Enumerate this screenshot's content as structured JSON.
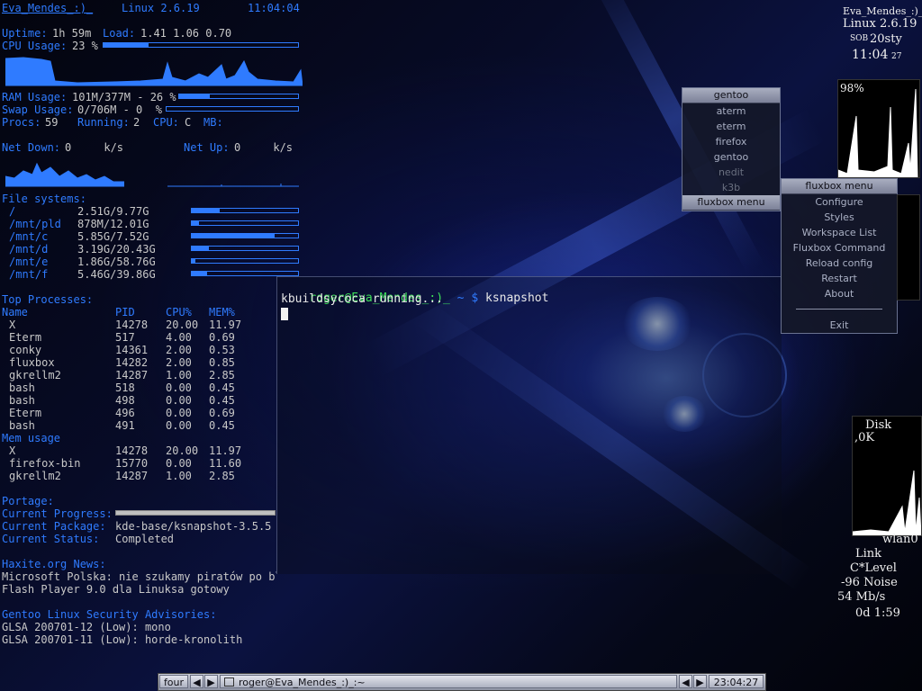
{
  "conky": {
    "hostname": "Eva_Mendes_:)_",
    "kernel": "Linux 2.6.19",
    "time": "11:04:04",
    "uptime_label": "Uptime:",
    "uptime_value": "1h 59m",
    "load_label": "Load:",
    "load_value": "1.41 1.06 0.70",
    "cpu_label": "CPU Usage:",
    "cpu_value": "23 %",
    "cpu_fraction": 0.23,
    "ram_label": "RAM Usage:",
    "ram_value": "101M/377M - 26 %",
    "ram_fraction": 0.26,
    "swap_label": "Swap Usage:",
    "swap_value": "0/706M - 0  %",
    "swap_fraction": 0.0,
    "procs_label": "Procs:",
    "procs_value": "59",
    "running_label": "Running:",
    "running_value": "2",
    "cpu2_label": "CPU:",
    "cpu2_value": "C",
    "mb_label": "MB:",
    "netdown_label": "Net Down:",
    "netdown_value": "0     k/s",
    "netup_label": "Net Up:",
    "netup_value": "0     k/s",
    "fs_header": "File systems:",
    "filesystems": [
      {
        "mount": "/",
        "usage": "2.51G/9.77G",
        "fraction": 0.26
      },
      {
        "mount": "/mnt/pld",
        "usage": "878M/12.01G",
        "fraction": 0.07
      },
      {
        "mount": "/mnt/c",
        "usage": "5.85G/7.52G",
        "fraction": 0.78
      },
      {
        "mount": "/mnt/d",
        "usage": "3.19G/20.43G",
        "fraction": 0.16
      },
      {
        "mount": "/mnt/e",
        "usage": "1.86G/58.76G",
        "fraction": 0.03
      },
      {
        "mount": "/mnt/f",
        "usage": "5.46G/39.86G",
        "fraction": 0.14
      }
    ],
    "top_header": "Top Processes:",
    "cols": {
      "name": "Name",
      "pid": "PID",
      "cpu": "CPU%",
      "mem": "MEM%"
    },
    "top_processes": [
      {
        "name": "X",
        "pid": "14278",
        "cpu": "20.00",
        "mem": "11.97"
      },
      {
        "name": "Eterm",
        "pid": "517",
        "cpu": "4.00",
        "mem": "0.69"
      },
      {
        "name": "conky",
        "pid": "14361",
        "cpu": "2.00",
        "mem": "0.53"
      },
      {
        "name": "fluxbox",
        "pid": "14282",
        "cpu": "2.00",
        "mem": "0.85"
      },
      {
        "name": "gkrellm2",
        "pid": "14287",
        "cpu": "1.00",
        "mem": "2.85"
      },
      {
        "name": "bash",
        "pid": "518",
        "cpu": "0.00",
        "mem": "0.45"
      },
      {
        "name": "bash",
        "pid": "498",
        "cpu": "0.00",
        "mem": "0.45"
      },
      {
        "name": "Eterm",
        "pid": "496",
        "cpu": "0.00",
        "mem": "0.69"
      },
      {
        "name": "bash",
        "pid": "491",
        "cpu": "0.00",
        "mem": "0.45"
      }
    ],
    "mem_header": "Mem usage",
    "mem_processes": [
      {
        "name": "X",
        "pid": "14278",
        "cpu": "20.00",
        "mem": "11.97"
      },
      {
        "name": "firefox-bin",
        "pid": "15770",
        "cpu": "0.00",
        "mem": "11.60"
      },
      {
        "name": "gkrellm2",
        "pid": "14287",
        "cpu": "1.00",
        "mem": "2.85"
      }
    ],
    "portage_header": "Portage:",
    "progress_label": "Current Progress:",
    "progress_fraction": 1.0,
    "package_label": "Current Package:",
    "package_value": "kde-base/ksnapshot-3.5.5",
    "status_label": "Current Status:",
    "status_value": "Completed",
    "news_header": "Haxite.org News:",
    "news": [
      "Microsoft Polska: nie szukamy piratów po bl",
      "Flash Player 9.0 dla Linuksa gotowy"
    ],
    "security_header": "Gentoo Linux Security Advisories:",
    "advisories": [
      "GLSA 200701-12 (Low): mono",
      "GLSA 200701-11 (Low): horde-kronolith"
    ]
  },
  "gentoo_menu": {
    "title": "gentoo",
    "items": [
      "aterm",
      "eterm",
      "firefox",
      "gentoo",
      "nedit",
      "k3b"
    ],
    "footer": "fluxbox menu"
  },
  "fluxbox_menu": {
    "title": "fluxbox menu",
    "items": [
      "Configure",
      "Styles",
      "Workspace List",
      "Fluxbox Command",
      "Reload config",
      "Restart",
      "About"
    ],
    "exit": "Exit"
  },
  "terminal": {
    "prompt_user": "roger@Eva_Mendes_:)_",
    "prompt_path": " ~ $ ",
    "command": "ksnapshot",
    "output": "kbuildsycoca running..."
  },
  "gkrellm": {
    "hostname": "Eva_Mendes_:)_",
    "kernel": "Linux 2.6.19",
    "day": "sob",
    "date": "20sty",
    "time": "11:04",
    "seconds": "27",
    "cpu_percent": "98%",
    "disk_label": "Disk",
    "disk_value": ",0K",
    "wlan_label": "wlan0",
    "link_label": "Link",
    "level_label": "C*Level",
    "noise_label": "-96 Noise",
    "rate_label": "54 Mb/s",
    "uptime": "0d 1:59"
  },
  "toolbar": {
    "workspace": "four",
    "window_title": "roger@Eva_Mendes_:)_:~",
    "clock": "23:04:27",
    "prev_arrow": "◀",
    "next_arrow": "▶"
  },
  "colors": {
    "conky_blue": "#2f7bff",
    "prompt_green": "#3ee05a",
    "text_gray": "#c8c8c8"
  }
}
